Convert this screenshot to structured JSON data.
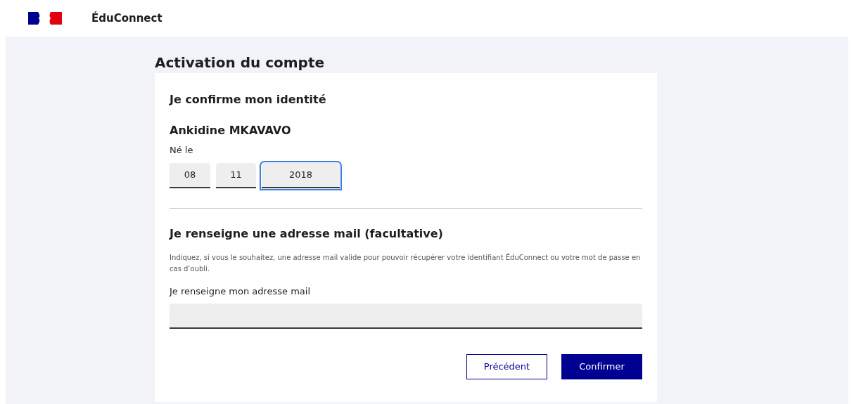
{
  "header": {
    "brand": "ÉduConnect"
  },
  "page_title": "Activation du compte",
  "identity": {
    "heading": "Je confirme mon identité",
    "name": "Ankidine MKAVAVO",
    "birth_label": "Né le",
    "date_fields": [
      {
        "value": "08",
        "focused": false
      },
      {
        "value": "11",
        "focused": false
      },
      {
        "value": "2018",
        "focused": true
      }
    ]
  },
  "email_section": {
    "heading": "Je renseigne une adresse mail (facultative)",
    "description": "Indiquez, si vous le souhaitez, une adresse mail valide pour pouvoir récupérer votre identifiant ÉduConnect ou votre mot de passe en cas d’oubli.",
    "field_label": "Je renseigne mon adresse mail"
  },
  "buttons": [
    {
      "label": "Précédent",
      "kind": "secondary"
    },
    {
      "label": "Confirmer",
      "kind": "primary"
    }
  ]
}
